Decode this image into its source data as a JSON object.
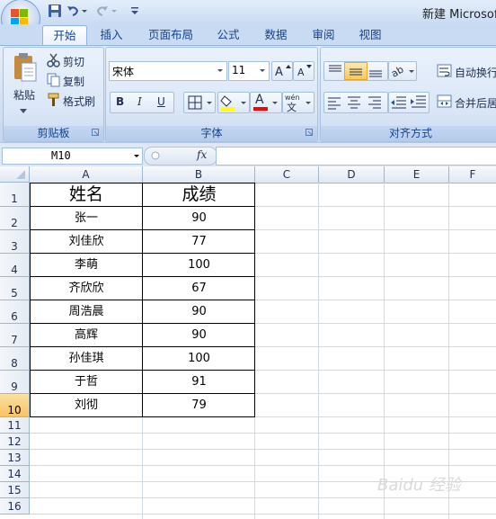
{
  "window": {
    "title": "新建 Microsof"
  },
  "tabs": [
    {
      "label": "开始",
      "active": true
    },
    {
      "label": "插入"
    },
    {
      "label": "页面布局"
    },
    {
      "label": "公式"
    },
    {
      "label": "数据"
    },
    {
      "label": "审阅"
    },
    {
      "label": "视图"
    }
  ],
  "clipboard": {
    "paste": "粘贴",
    "cut": "剪切",
    "copy": "复制",
    "format_painter": "格式刷",
    "group": "剪贴板"
  },
  "font": {
    "name": "宋体",
    "size": "11",
    "bold": "B",
    "italic": "I",
    "underline": "U",
    "font_color_letter": "A",
    "phonetic": "wén",
    "group": "字体",
    "fill_color": "#ffff00",
    "font_color": "#ff0000"
  },
  "alignment": {
    "wrap": "自动换行",
    "merge": "合并后居",
    "group": "对齐方式"
  },
  "formula_bar": {
    "cell_ref": "M10",
    "fx": "fx",
    "content": ""
  },
  "columns": [
    "A",
    "B",
    "C",
    "D",
    "E",
    "F"
  ],
  "rows": [
    "1",
    "2",
    "3",
    "4",
    "5",
    "6",
    "7",
    "8",
    "9",
    "10",
    "11",
    "12",
    "13",
    "14",
    "15",
    "16"
  ],
  "selected_row": "10",
  "table": {
    "headers": [
      "姓名",
      "成绩"
    ],
    "rows": [
      [
        "张一",
        "90"
      ],
      [
        "刘佳欣",
        "77"
      ],
      [
        "李萌",
        "100"
      ],
      [
        "齐欣欣",
        "67"
      ],
      [
        "周浩晨",
        "90"
      ],
      [
        "高辉",
        "90"
      ],
      [
        "孙佳琪",
        "100"
      ],
      [
        "于哲",
        "91"
      ],
      [
        "刘彻",
        "79"
      ]
    ]
  },
  "watermark": "Baidu 经验"
}
